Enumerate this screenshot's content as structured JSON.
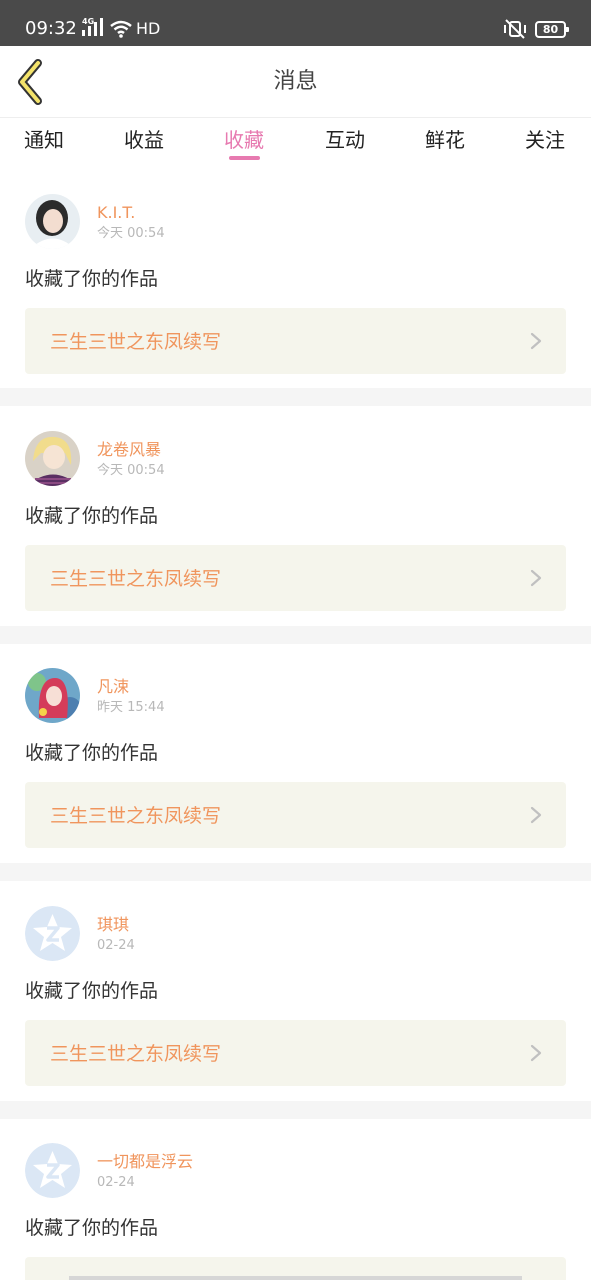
{
  "status_bar": {
    "time": "09:32",
    "network": "4G",
    "hd_label": "HD",
    "battery": "80"
  },
  "header": {
    "back_icon": "chevron-left-icon",
    "title": "消息"
  },
  "tabs": [
    {
      "label": "通知"
    },
    {
      "label": "收益"
    },
    {
      "label": "收藏",
      "active": true
    },
    {
      "label": "互动"
    },
    {
      "label": "鲜花"
    },
    {
      "label": "关注"
    }
  ],
  "colors": {
    "accent": "#e77ab0",
    "username": "#f0955d",
    "work_link_bg": "#f5f5ec",
    "page_bg": "#f5f5f5"
  },
  "messages": [
    {
      "username": "K.I.T.",
      "time": "今天 00:54",
      "action": "收藏了你的作品",
      "work_title": "三生三世之东凤续写",
      "avatar_icon": "portrait-avatar"
    },
    {
      "username": "龙卷风暴",
      "time": "今天 00:54",
      "action": "收藏了你的作品",
      "work_title": "三生三世之东凤续写",
      "avatar_icon": "anime-girl-avatar"
    },
    {
      "username": "凡涑",
      "time": "昨天 15:44",
      "action": "收藏了你的作品",
      "work_title": "三生三世之东凤续写",
      "avatar_icon": "anime-art-avatar"
    },
    {
      "username": "琪琪",
      "time": "02-24",
      "action": "收藏了你的作品",
      "work_title": "三生三世之东凤续写",
      "avatar_icon": "default-star-avatar"
    },
    {
      "username": "一切都是浮云",
      "time": "02-24",
      "action": "收藏了你的作品",
      "avatar_icon": "default-star-avatar"
    }
  ]
}
